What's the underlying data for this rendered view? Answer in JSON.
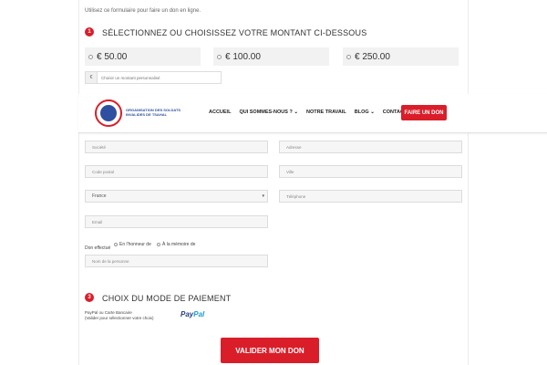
{
  "intro": "Utilisez ce formulaire pour faire un don en ligne.",
  "step1": {
    "number": "1",
    "title": "SÉLECTIONNEZ OU CHOISISSEZ VOTRE MONTANT CI-DESSOUS"
  },
  "amounts": [
    "€ 50.00",
    "€ 100.00",
    "€ 250.00"
  ],
  "custom": {
    "currency": "€",
    "placeholder": "Choisir un montant personnalisé"
  },
  "header": {
    "logo_text": "ORGANISATION DES SOLDATS INVALIDES DE TSAHAL",
    "nav": [
      "ACCUEIL",
      "QUI SOMMES-NOUS ?",
      "NOTRE TRAVAIL",
      "BLOG",
      "CONTACT"
    ],
    "cta": "FAIRE UN DON"
  },
  "form": {
    "societe": "Société",
    "adresse": "Adresse",
    "code_postal": "Code postal",
    "ville": "Ville",
    "pays": "France",
    "telephone": "Téléphone",
    "email": "Email",
    "don_effectue": "Don effectué",
    "honneur": "En l'honneur de",
    "memoire": "À la mémoire de",
    "nom_personne": "Nom de la personne"
  },
  "step3": {
    "number": "3",
    "title": "CHOIX DU MODE DE PAIEMENT",
    "method_line1": "PayPal ou Carte Bancaire",
    "method_line2": "(Valider pour sélectionner votre choix)",
    "paypal_a": "Pay",
    "paypal_b": "Pal"
  },
  "submit": "VALIDER MON DON",
  "colors": {
    "accent": "#d91e2a",
    "logo_blue": "#2f4fa0"
  }
}
